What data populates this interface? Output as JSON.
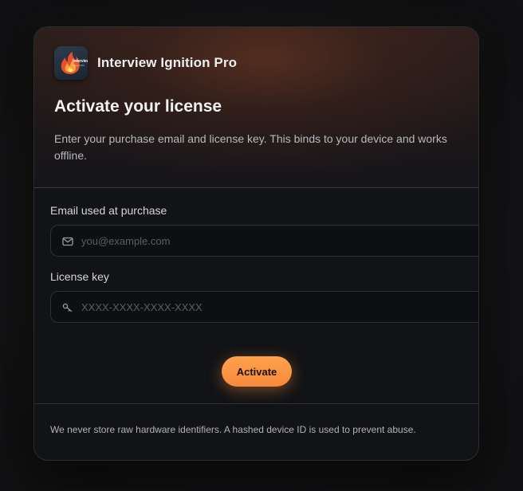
{
  "brand": {
    "app_name": "Interview Ignition Pro",
    "icon_text": "Interview Ignition Pro",
    "icon": "flame-logo-icon"
  },
  "header": {
    "title": "Activate your license",
    "subtitle": "Enter your purchase email and license key. This binds to your device and works offline."
  },
  "form": {
    "email": {
      "label": "Email used at purchase",
      "placeholder": "you@example.com",
      "value": "",
      "icon": "mail-icon"
    },
    "license": {
      "label": "License key",
      "placeholder": "XXXX-XXXX-XXXX-XXXX",
      "value": "",
      "icon": "key-icon"
    },
    "submit_label": "Activate"
  },
  "footer": {
    "note": "We never store raw hardware identifiers. A hashed device ID is used to prevent abuse."
  },
  "colors": {
    "accent": "#f7893a",
    "accent_light": "#ffa24d",
    "background": "#121316"
  }
}
